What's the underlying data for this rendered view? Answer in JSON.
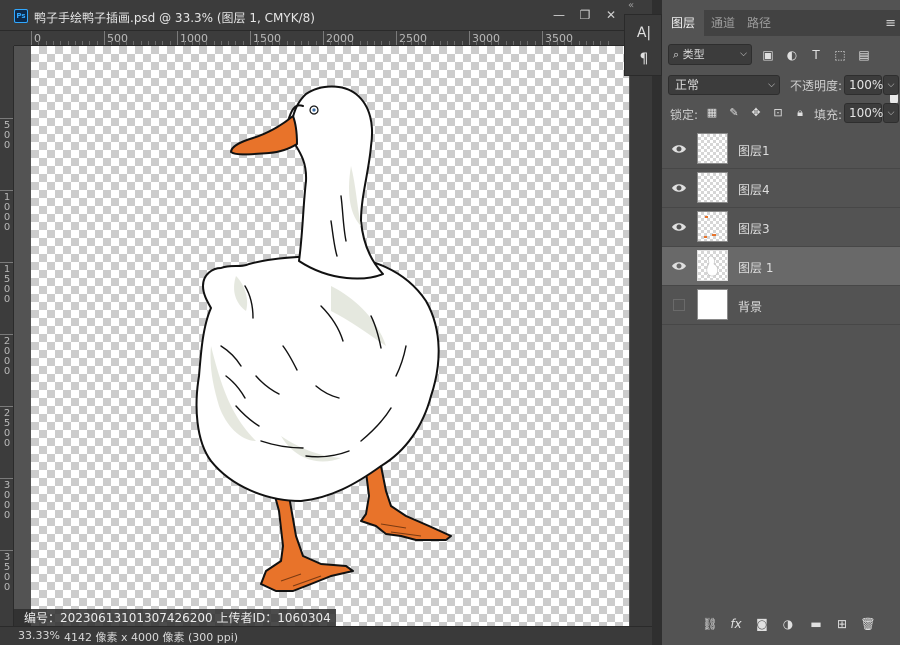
{
  "document": {
    "title": "鸭子手绘鸭子插画.psd @ 33.3% (图层 1, CMYK/8)",
    "ps_badge": "Ps",
    "window_buttons": {
      "minimize": "—",
      "restore": "❐",
      "close": "✕"
    }
  },
  "ruler": {
    "top_labels": [
      "0",
      "500",
      "1000",
      "1500",
      "2000",
      "2500",
      "3000",
      "3500"
    ],
    "left_labels": [
      "500",
      "1000",
      "1500",
      "2000",
      "2500",
      "3000",
      "3500"
    ]
  },
  "status": {
    "zoom": "33.33%",
    "doc_info": "4142 像素 x 4000 像素 (300 ppi)"
  },
  "watermark": {
    "text": "编号：20230613101307426200  上传者ID：1060304"
  },
  "mini_toolbar": {
    "character_icon": "A|",
    "paragraph_icon": "¶"
  },
  "layers_panel": {
    "tabs": [
      {
        "label": "图层",
        "active": true
      },
      {
        "label": "通道",
        "active": false
      },
      {
        "label": "路径",
        "active": false
      }
    ],
    "filter": {
      "label": "类型"
    },
    "blend_mode": "正常",
    "opacity_label": "不透明度:",
    "opacity_value": "100%",
    "lock_label": "锁定:",
    "fill_label": "填充:",
    "fill_value": "100%",
    "layers": [
      {
        "name": "图层1",
        "visible": true,
        "selected": false
      },
      {
        "name": "图层4",
        "visible": true,
        "selected": false
      },
      {
        "name": "图层3",
        "visible": true,
        "selected": false
      },
      {
        "name": "图层 1",
        "visible": true,
        "selected": true
      },
      {
        "name": "背景",
        "visible": false,
        "selected": false
      }
    ]
  },
  "colors": {
    "goose_orange": "#e8732a",
    "goose_white": "#ffffff",
    "goose_shadow": "#e3e6dc",
    "ui_dark": "#3c3c3c",
    "ui_panel": "#535353"
  }
}
